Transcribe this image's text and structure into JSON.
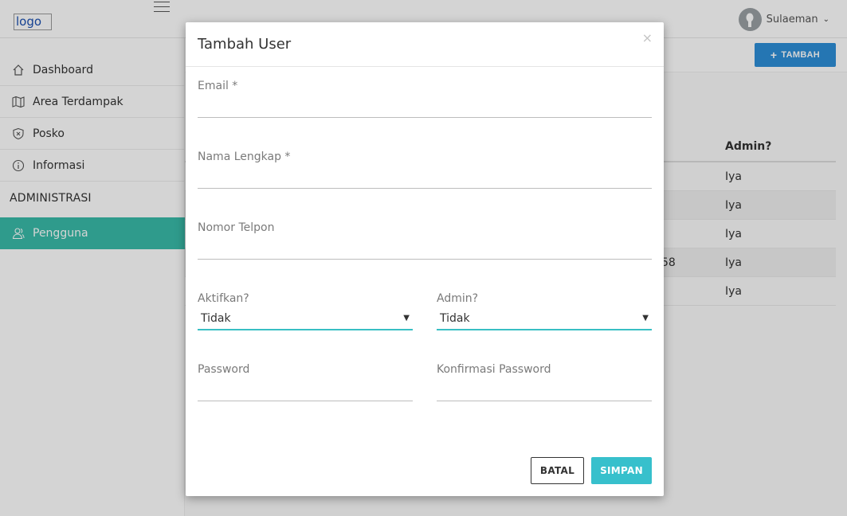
{
  "topbar": {
    "logo_alt": "logo",
    "user_name": "Sulaeman",
    "user_chevron": "⌄"
  },
  "sidebar": {
    "items": [
      {
        "label": "Dashboard",
        "icon": "home-icon"
      },
      {
        "label": "Area Terdampak",
        "icon": "map-icon"
      },
      {
        "label": "Posko",
        "icon": "shield-icon"
      },
      {
        "label": "Informasi",
        "icon": "info-icon"
      }
    ],
    "section_label": "ADMINISTRASI",
    "admin_items": [
      {
        "label": "Pengguna",
        "icon": "users-icon",
        "active": true
      }
    ]
  },
  "main": {
    "add_button_label": "TAMBAH",
    "table": {
      "header_admin": "Admin?",
      "rows": [
        {
          "partial": "",
          "admin": "Iya"
        },
        {
          "partial": "",
          "admin": "Iya"
        },
        {
          "partial": "",
          "admin": "Iya"
        },
        {
          "partial": "58",
          "admin": "Iya"
        },
        {
          "partial": "",
          "admin": "Iya"
        }
      ]
    }
  },
  "modal": {
    "title": "Tambah User",
    "close_symbol": "×",
    "fields": {
      "email": {
        "label": "Email *",
        "value": ""
      },
      "nama_lengkap": {
        "label": "Nama Lengkap *",
        "value": ""
      },
      "nomor_telpon": {
        "label": "Nomor Telpon",
        "value": ""
      },
      "aktifkan": {
        "label": "Aktifkan?",
        "value": "Tidak"
      },
      "admin": {
        "label": "Admin?",
        "value": "Tidak"
      },
      "password": {
        "label": "Password",
        "value": ""
      },
      "konfirmasi_password": {
        "label": "Konfirmasi Password",
        "value": ""
      }
    },
    "cancel_label": "BATAL",
    "save_label": "SIMPAN"
  },
  "colors": {
    "accent_teal": "#39bba9",
    "primary_blue": "#2d8fd8",
    "save_cyan": "#37c0cc"
  }
}
